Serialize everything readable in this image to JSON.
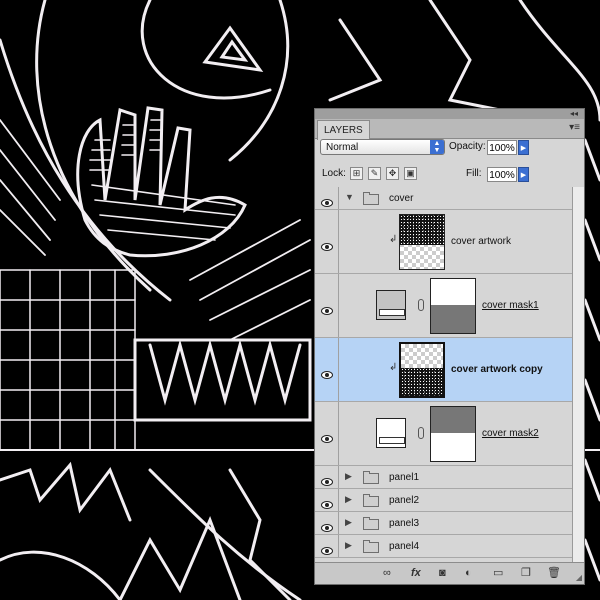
{
  "panel": {
    "tab_label": "LAYERS",
    "blend_mode": "Normal",
    "opacity_label": "Opacity:",
    "opacity_value": "100%",
    "lock_label": "Lock:",
    "fill_label": "Fill:",
    "fill_value": "100%"
  },
  "layers": [
    {
      "name": "cover",
      "kind": "group",
      "expanded": true
    },
    {
      "name": "cover artwork",
      "kind": "clipped-layer"
    },
    {
      "name": "cover mask1",
      "kind": "adjustment-with-mask"
    },
    {
      "name": "cover artwork copy",
      "kind": "clipped-layer",
      "selected": true
    },
    {
      "name": "cover mask2",
      "kind": "adjustment-with-mask"
    },
    {
      "name": "panel1",
      "kind": "group",
      "expanded": false
    },
    {
      "name": "panel2",
      "kind": "group",
      "expanded": false
    },
    {
      "name": "panel3",
      "kind": "group",
      "expanded": false
    },
    {
      "name": "panel4",
      "kind": "group",
      "expanded": false
    }
  ],
  "footer_icons": [
    "link-icon",
    "fx-icon",
    "add-mask-icon",
    "adjustment-icon",
    "new-group-icon",
    "new-layer-icon",
    "trash-icon"
  ],
  "colors": {
    "selection": "#b6d3f5",
    "accent": "#3b6fd2",
    "panel": "#d6d6d6"
  }
}
